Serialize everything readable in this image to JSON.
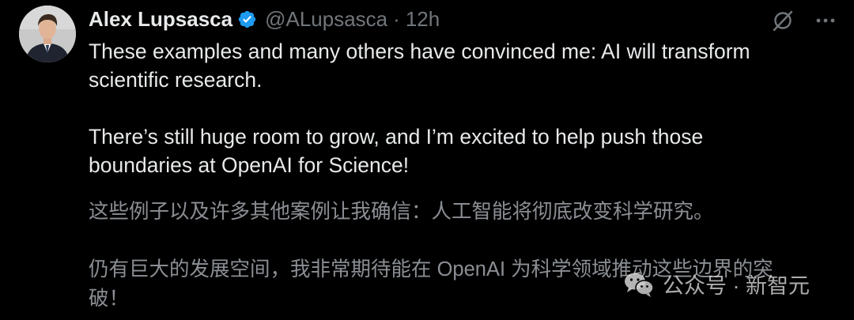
{
  "tweet": {
    "author": {
      "name": "Alex Lupsasca",
      "handle": "@ALupsasca",
      "separator": "·",
      "time": "12h",
      "verified": true
    },
    "icons": {
      "grok": "grok-icon",
      "more": "more-icon",
      "verified": "verified-badge-icon"
    },
    "text": {
      "paragraph_1_line_1": "These examples and many others have convinced me: AI will transform",
      "paragraph_1_line_2": "scientific research.",
      "paragraph_2_line_1": "There’s still huge room to grow, and I’m excited to help push those",
      "paragraph_2_line_2": "boundaries at OpenAI for Science!"
    },
    "translation": {
      "line_1": "这些例子以及许多其他案例让我确信：人工智能将彻底改变科学研究。",
      "line_2": "仍有巨大的发展空间，我非常期待能在 OpenAI 为科学领域推动这些边界的突",
      "line_3": "破！"
    }
  },
  "watermark": {
    "text": "公众号 · 新智元",
    "icon": "wechat-icon"
  },
  "colors": {
    "background": "#000000",
    "primary_text": "#e7e9ea",
    "secondary_text": "#71767b",
    "translation_text": "#8b8f94",
    "verified_blue": "#1d9bf0"
  }
}
